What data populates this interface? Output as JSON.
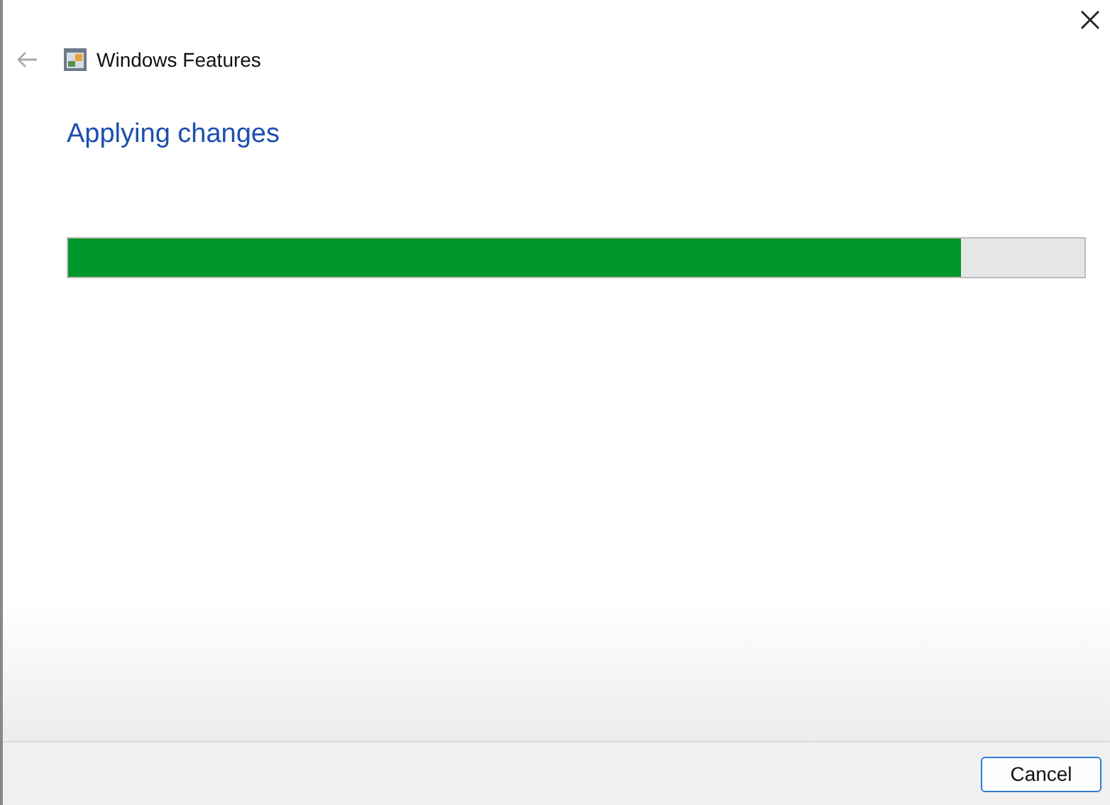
{
  "window": {
    "title": "Windows Features"
  },
  "heading": "Applying changes",
  "progress": {
    "level": 0.879
  },
  "buttons": [
    "Cancel"
  ]
}
